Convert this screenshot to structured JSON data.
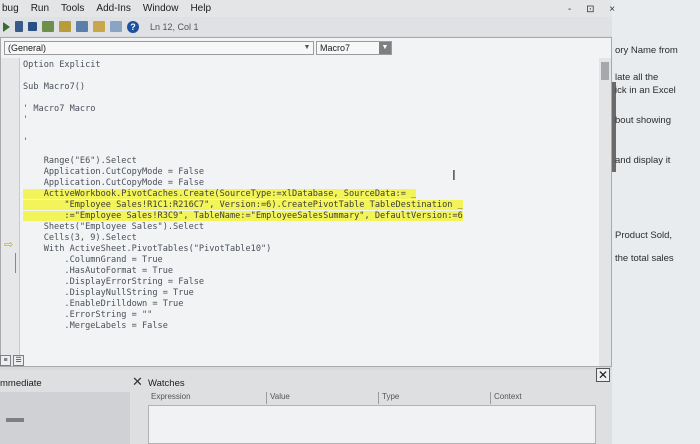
{
  "menu": {
    "items": [
      "bug",
      "Run",
      "Tools",
      "Add-Ins",
      "Window",
      "Help"
    ],
    "window_controls": "- ⊡ ×"
  },
  "toolbar": {
    "position": "Ln 12, Col 1",
    "help_glyph": "?"
  },
  "code_window": {
    "object_combo": "(General)",
    "procedure_combo": "Macro7",
    "lines": [
      "Option Explicit",
      "",
      "Sub Macro7()",
      "",
      "' Macro7 Macro",
      "'",
      "",
      "'",
      "    Range(\"E6\").Select",
      "    Application.CutCopyMode = False",
      "    Application.CutCopyMode = False",
      "    ActiveWorkbook.PivotCaches.Create(SourceType:=xlDatabase, SourceData:= _",
      "        \"Employee Sales!R1C1:R216C7\", Version:=6).CreatePivotTable TableDestination _",
      "        :=\"Employee Sales!R3C9\", TableName:=\"EmployeeSalesSummary\", DefaultVersion:=6",
      "    Sheets(\"Employee Sales\").Select",
      "    Cells(3, 9).Select",
      "    With ActiveSheet.PivotTables(\"PivotTable10\")",
      "        .ColumnGrand = True",
      "        .HasAutoFormat = True",
      "        .DisplayErrorString = False",
      "        .DisplayNullString = True",
      "        .EnableDrilldown = True",
      "        .ErrorString = \"\"",
      "        .MergeLabels = False"
    ]
  },
  "immediate": {
    "title": "mmediate"
  },
  "watches": {
    "title": "Watches",
    "columns": [
      "Expression",
      "Value",
      "Type",
      "Context"
    ]
  },
  "background_doc": {
    "lines": [
      "ory Name from",
      "late all the",
      "ick in an Excel",
      "bout showing",
      "and display it",
      "Product Sold,",
      "the total sales"
    ]
  },
  "colors": {
    "highlight": "#f3f35a",
    "code_text": "#4a4f5a"
  }
}
